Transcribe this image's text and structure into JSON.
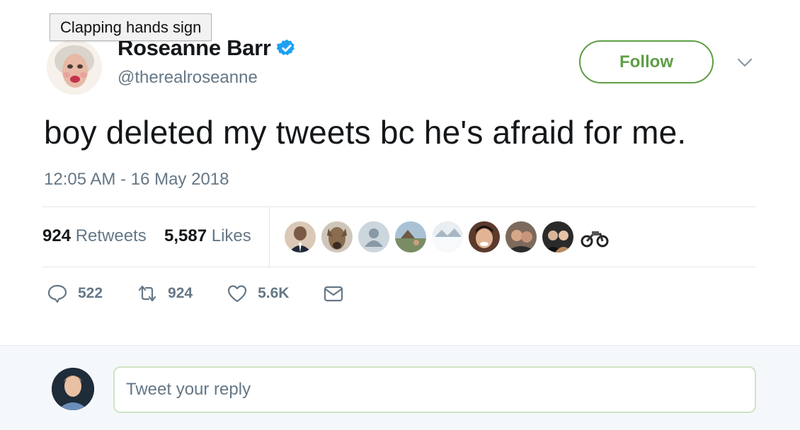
{
  "tooltip": "Clapping hands sign",
  "author": {
    "name": "Roseanne Barr",
    "handle": "@therealroseanne",
    "verified": true
  },
  "follow_label": "Follow",
  "tweet": {
    "text": "boy deleted my tweets bc he's afraid for me.",
    "timestamp": "12:05 AM - 16 May 2018"
  },
  "stats": {
    "retweets_count": "924",
    "retweets_label": "Retweets",
    "likes_count": "5,587",
    "likes_label": "Likes"
  },
  "likers": [
    "liker-1",
    "liker-2",
    "liker-3",
    "liker-4",
    "liker-5",
    "liker-6",
    "liker-7",
    "liker-8",
    "liker-9"
  ],
  "actions": {
    "replies": "522",
    "retweets": "924",
    "likes": "5.6K"
  },
  "reply": {
    "placeholder": "Tweet your reply"
  },
  "colors": {
    "follow_accent": "#5e9e46",
    "verified_blue": "#1da1f2",
    "muted_text": "#657786"
  }
}
